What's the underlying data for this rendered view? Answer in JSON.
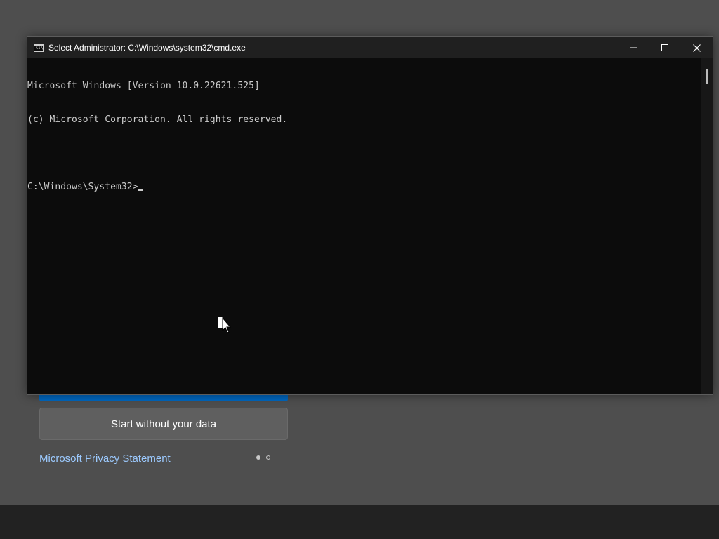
{
  "setup": {
    "secondary_button": "Start without your data",
    "privacy_link": "Microsoft Privacy Statement",
    "pager_total": 2,
    "pager_current": 1
  },
  "cmd": {
    "title": "Select Administrator: C:\\Windows\\system32\\cmd.exe",
    "lines": [
      "Microsoft Windows [Version 10.0.22621.525]",
      "(c) Microsoft Corporation. All rights reserved.",
      "",
      "C:\\Windows\\System32>"
    ],
    "icon": "console-icon",
    "buttons": {
      "minimize": "minimize-icon",
      "maximize": "maximize-icon",
      "close": "close-icon"
    }
  },
  "colors": {
    "console_bg": "#0c0c0c",
    "console_text": "#cccccc",
    "titlebar_bg": "#202020",
    "accent_blue": "#0067c0",
    "link": "#9ccaff"
  }
}
